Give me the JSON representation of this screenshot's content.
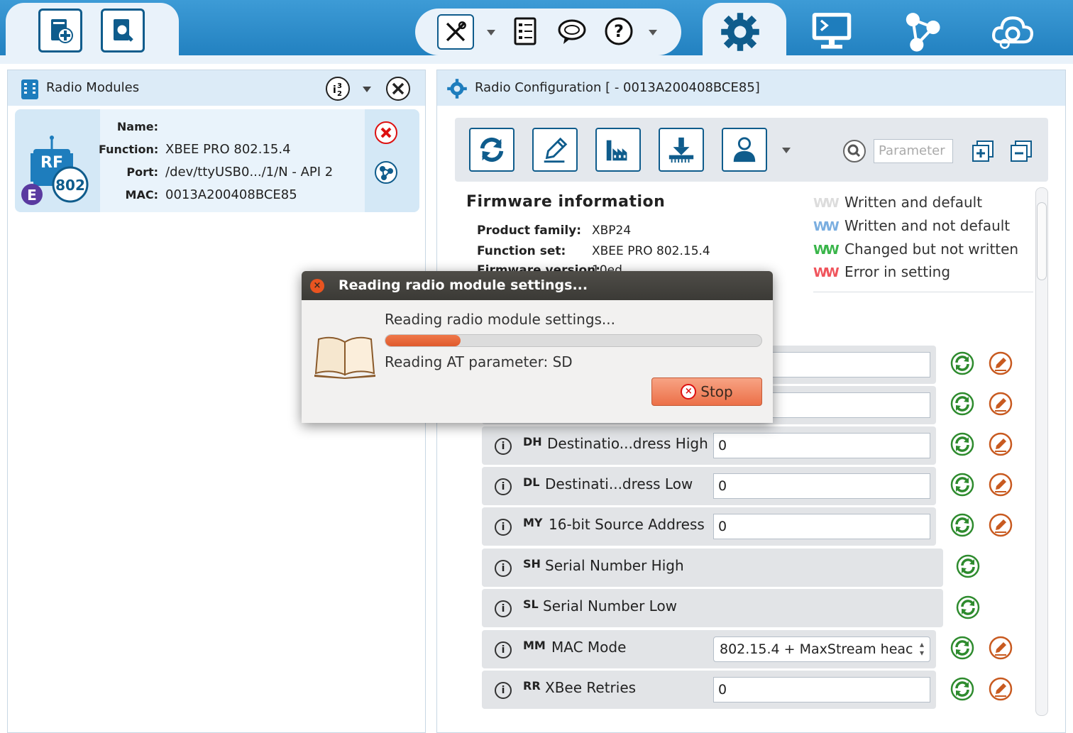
{
  "toolbar": {
    "left_icons": [
      "add-device-icon",
      "discover-devices-icon"
    ],
    "mid_icons": [
      "tools-icon",
      "dropdown-arrow",
      "profile-icon",
      "chat-icon",
      "help-icon",
      "dropdown-arrow"
    ],
    "mode_icons": [
      "configuration-gear-icon",
      "console-icon",
      "network-icon",
      "cloud-settings-icon"
    ]
  },
  "radio_modules": {
    "title": "Radio Modules",
    "module": {
      "name_label": "Name:",
      "name_value": "",
      "function_label": "Function:",
      "function_value": "XBEE PRO 802.15.4",
      "port_label": "Port:",
      "port_value": "/dev/ttyUSB0.../1/N - API 2",
      "mac_label": "MAC:",
      "mac_value": "0013A200408BCE85",
      "badge_text": "802",
      "chip_text": "RF",
      "e_badge": "E"
    }
  },
  "radio_config": {
    "title": "Radio Configuration [ - 0013A200408BCE85]",
    "search_placeholder": "Parameter",
    "firmware": {
      "title": "Firmware information",
      "rows": [
        {
          "label": "Product family:",
          "value": "XBP24"
        },
        {
          "label": "Function set:",
          "value": "XBEE PRO 802.15.4"
        },
        {
          "label": "Firmware version:",
          "value": "10ed"
        }
      ]
    },
    "legend": [
      {
        "label": "Written and default",
        "color": "#dcdcdc"
      },
      {
        "label": "Written and not default",
        "color": "#7aaee0"
      },
      {
        "label": "Changed but not written",
        "color": "#39b54a"
      },
      {
        "label": "Error in setting",
        "color": "#f0545c"
      }
    ],
    "params": [
      {
        "code": "DH",
        "name": "Destinatio...dress High",
        "value": "0"
      },
      {
        "code": "DL",
        "name": "Destinati...dress Low",
        "value": "0"
      },
      {
        "code": "MY",
        "name": "16-bit Source Address",
        "value": "0"
      },
      {
        "code": "SH",
        "name": "Serial Number High",
        "value": ""
      },
      {
        "code": "SL",
        "name": "Serial Number Low",
        "value": ""
      },
      {
        "code": "MM",
        "name": "MAC Mode",
        "value": "802.15.4 + MaxStream heac"
      },
      {
        "code": "RR",
        "name": "XBee Retries",
        "value": "0"
      }
    ],
    "info_glyph": "i"
  },
  "dialog": {
    "title": "Reading radio module settings...",
    "message": "Reading radio module settings...",
    "progress": 0.2,
    "status": "Reading AT parameter: SD",
    "stop_label": "Stop",
    "close_glyph": "×",
    "stop_glyph": "×"
  },
  "colors": {
    "accent_blue": "#1e7dbd",
    "dialog_orange": "#ec7048",
    "green_refresh": "#2e8b2e",
    "edit_orange": "#c85a20"
  }
}
